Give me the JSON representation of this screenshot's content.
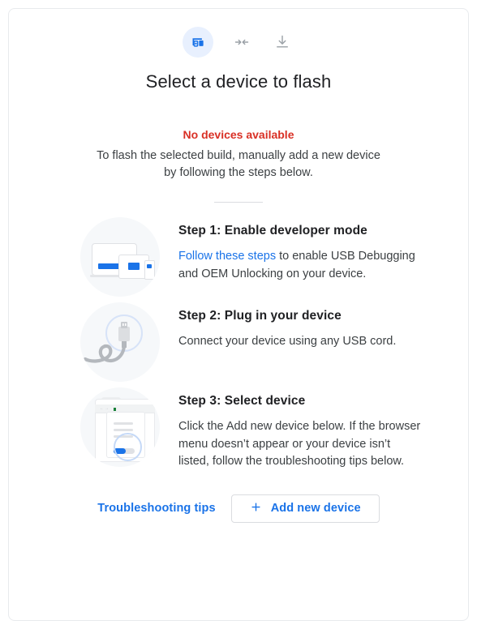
{
  "header": {
    "icons": [
      {
        "name": "devices-icon",
        "state": "active"
      },
      {
        "name": "connect-arrows-icon",
        "state": "inactive"
      },
      {
        "name": "download-icon",
        "state": "inactive"
      }
    ],
    "title": "Select a device to flash"
  },
  "status": {
    "headline": "No devices available",
    "description": "To flash the selected build, manually add a new device by following the steps below."
  },
  "steps": [
    {
      "title": "Step 1: Enable developer mode",
      "link_text": "Follow these steps",
      "text_after_link": " to enable USB Debugging and OEM Unlocking on your device.",
      "art": "devices-illustration"
    },
    {
      "title": "Step 2: Plug in your device",
      "link_text": "",
      "text_after_link": "Connect your device using any USB cord.",
      "art": "usb-cable-illustration"
    },
    {
      "title": "Step 3: Select device",
      "link_text": "",
      "text_after_link": "Click the Add new device below. If the browser menu doesn’t appear or your device isn’t listed, follow the troubleshooting tips below.",
      "art": "browser-menu-illustration"
    }
  ],
  "footer": {
    "troubleshooting_label": "Troubleshooting tips",
    "add_device_label": "Add new device",
    "add_icon": "plus-icon"
  },
  "colors": {
    "accent_blue": "#1a73e8",
    "error_red": "#d93025",
    "icon_chip_bg": "#e8f0fe",
    "art_circle_bg": "#f6f8fa",
    "border": "#dadce0",
    "text_primary": "#202124",
    "text_secondary": "#3c4043"
  }
}
